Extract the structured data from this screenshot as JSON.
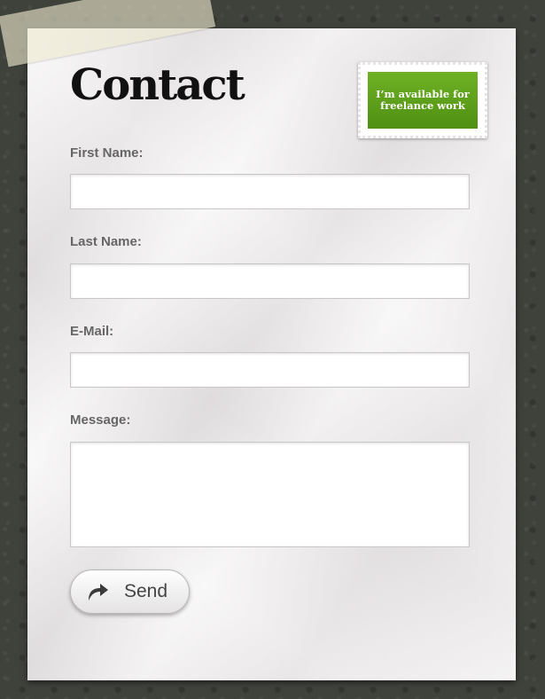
{
  "page": {
    "title": "Contact",
    "freelance_badge": "I’m available for\nfreelance work"
  },
  "form": {
    "first_name_label": "First Name:",
    "last_name_label": "Last Name:",
    "email_label": "E-Mail:",
    "message_label": "Message:",
    "first_name_value": "",
    "last_name_value": "",
    "email_value": "",
    "message_value": "",
    "send_label": "Send",
    "send_icon": "reply-arrow-icon"
  },
  "colors": {
    "background": "#3f413b",
    "paper": "#ece9ea",
    "badge_green": "#5e9f1b",
    "label_gray": "#666666"
  }
}
